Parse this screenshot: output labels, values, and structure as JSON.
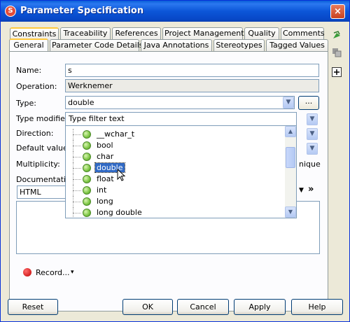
{
  "window": {
    "title": "Parameter Specification",
    "icon_letter": "S",
    "close_glyph": "×"
  },
  "tabs_row1": [
    "Constraints",
    "Traceability",
    "References",
    "Project Management",
    "Quality",
    "Comments"
  ],
  "tabs_row2": [
    "General",
    "Parameter Code Details",
    "Java Annotations",
    "Stereotypes",
    "Tagged Values"
  ],
  "form": {
    "name_label": "Name:",
    "name_value": "s",
    "operation_label": "Operation:",
    "operation_value": "Werknemer",
    "type_label": "Type:",
    "type_value": "double",
    "type_browse": "...",
    "type_modifier_label": "Type modifier:",
    "direction_label": "Direction:",
    "default_value_label": "Default value:",
    "multiplicity_label": "Multiplicity:",
    "multiplicity_partial": "nique",
    "documentation_label": "Documentation",
    "doc_format_value": "HTML",
    "doc_more": "»"
  },
  "type_popup": {
    "filter_placeholder": "Type filter text",
    "items": [
      "__wchar_t",
      "bool",
      "char",
      "double",
      "float",
      "int",
      "long",
      "long double"
    ],
    "selected": "double"
  },
  "record": {
    "label": "Record...",
    "arrow": "▾"
  },
  "buttons": {
    "reset": "Reset",
    "ok": "OK",
    "cancel": "Cancel",
    "apply": "Apply",
    "help": "Help"
  },
  "colors": {
    "title_bar": "#0a5fd8",
    "selection": "#316ac5",
    "tab_accent": "#ffc83c",
    "dialog_bg": "#ece9d8"
  }
}
